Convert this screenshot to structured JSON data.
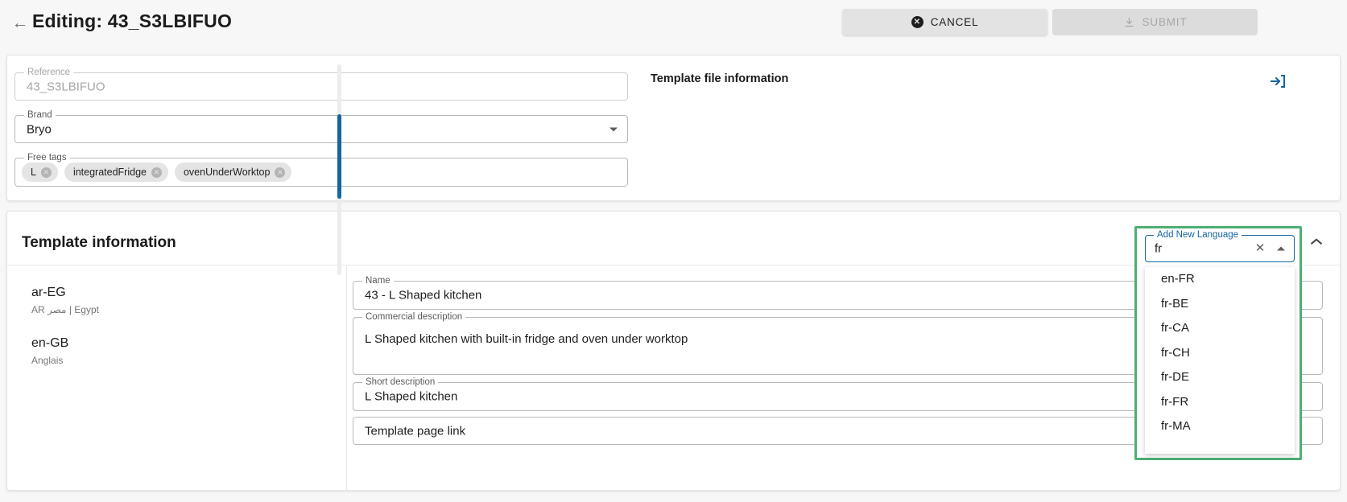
{
  "header": {
    "back_icon": "arrow-left-icon",
    "title": "Editing: 43_S3LBIFUO",
    "cancel_label": "CANCEL",
    "submit_label": "SUBMIT"
  },
  "top_card": {
    "reference": {
      "legend": "Reference",
      "value": "43_S3LBIFUO"
    },
    "brand": {
      "legend": "Brand",
      "value": "Bryo"
    },
    "free_tags": {
      "legend": "Free tags",
      "chips": [
        "L",
        "integratedFridge",
        "ovenUnderWorktop"
      ],
      "chip_remove_glyph": "✕"
    },
    "template_file_information": {
      "title": "Template file information",
      "action_icon": "enter-arrow-icon"
    }
  },
  "main_card": {
    "section_title": "Template information",
    "collapse_icon": "chevron-up-icon",
    "languages": [
      {
        "code": "ar-EG",
        "sub": "AR مصر | Egypt"
      },
      {
        "code": "en-GB",
        "sub": "Anglais"
      }
    ],
    "fields": {
      "name": {
        "legend": "Name",
        "value": "43 - L Shaped kitchen"
      },
      "commercial": {
        "legend": "Commercial description",
        "value": "L Shaped kitchen with built-in fridge and oven under worktop"
      },
      "short": {
        "legend": "Short description",
        "value": "L Shaped kitchen"
      },
      "page_link": {
        "legend": "",
        "value": "Template page link"
      }
    }
  },
  "add_language_dropdown": {
    "legend": "Add New Language",
    "value": "fr",
    "clear_glyph": "✕",
    "caret_icon": "chevron-up-icon",
    "options": [
      "en-FR",
      "fr-BE",
      "fr-CA",
      "fr-CH",
      "fr-DE",
      "fr-FR",
      "fr-MA"
    ],
    "highlight_color": "#4caf72",
    "focus_color": "#1565a0"
  }
}
